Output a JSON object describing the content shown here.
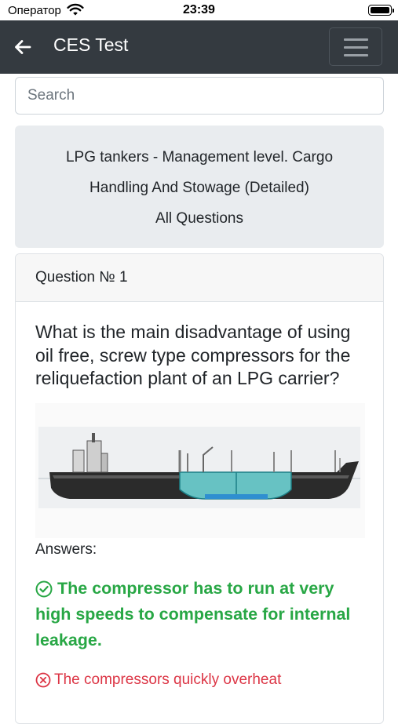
{
  "status": {
    "carrier": "Оператор",
    "time": "23:39"
  },
  "header": {
    "title": "CES Test"
  },
  "search": {
    "placeholder": "Search",
    "value": ""
  },
  "test_info": {
    "line1": "LPG tankers - Management level. Cargo",
    "line2": "Handling And Stowage (Detailed)",
    "line3": "All Questions"
  },
  "question": {
    "number_label": "Question № 1",
    "text": "What is the main disadvantage of using oil free, screw type compressors for the reliquefaction plant of an LPG carrier?",
    "answers_label": "Answers:",
    "answers": [
      {
        "text": "The compressor has to run at very high speeds to compensate for internal leakage.",
        "status": "correct"
      },
      {
        "text": "The compressors quickly overheat",
        "status": "wrong"
      }
    ]
  },
  "colors": {
    "app_bar": "#343a40",
    "correct": "#28a745",
    "wrong": "#dc3545",
    "card_bg": "#e9ecef"
  }
}
